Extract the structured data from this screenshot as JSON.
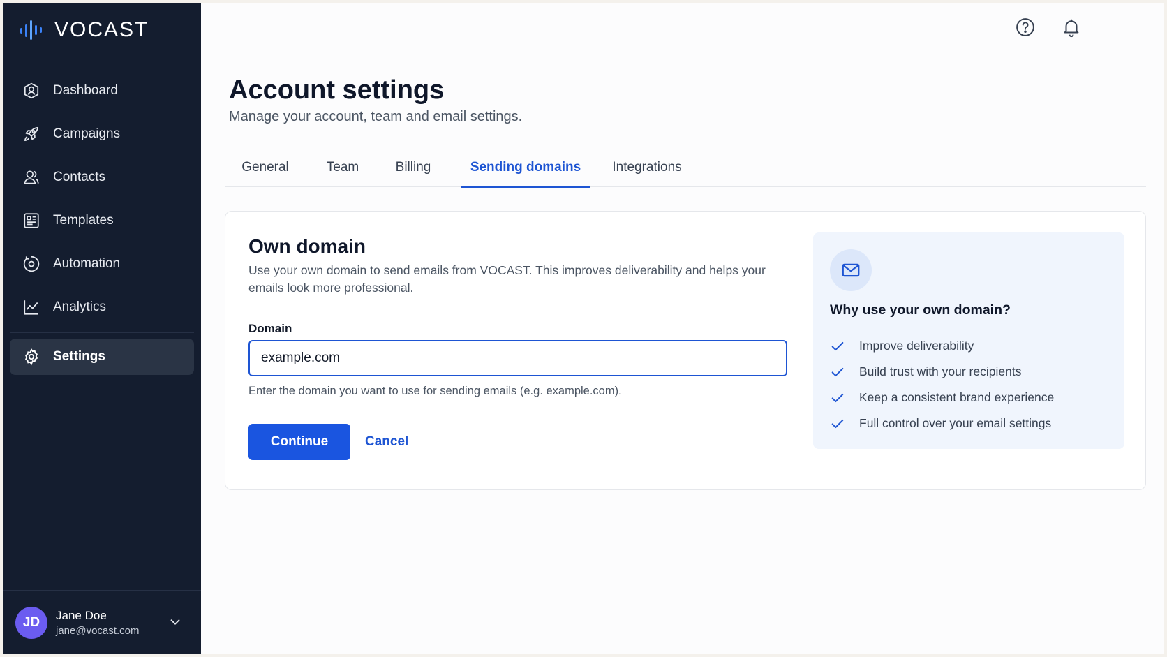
{
  "brand": {
    "name": "VOCAST",
    "accent": "#1a55e0",
    "sidebar_bg": "#141d2f"
  },
  "sidebar": {
    "items": [
      {
        "label": "Dashboard",
        "icon": "dashboard-icon"
      },
      {
        "label": "Campaigns",
        "icon": "rocket-icon"
      },
      {
        "label": "Contacts",
        "icon": "contacts-icon"
      },
      {
        "label": "Templates",
        "icon": "templates-icon"
      },
      {
        "label": "Automation",
        "icon": "automation-icon"
      },
      {
        "label": "Analytics",
        "icon": "analytics-icon"
      }
    ],
    "settings": {
      "label": "Settings",
      "icon": "gear-icon",
      "active": true
    },
    "user": {
      "initials": "JD",
      "name": "Jane Doe",
      "email": "jane@vocast.com"
    }
  },
  "header": {
    "title": "Account settings",
    "subtitle": "Manage your account, team and email settings."
  },
  "tabs": [
    {
      "label": "General"
    },
    {
      "label": "Team"
    },
    {
      "label": "Billing"
    },
    {
      "label": "Sending domains",
      "active": true
    },
    {
      "label": "Integrations"
    }
  ],
  "own_domain": {
    "title": "Own domain",
    "description": "Use your own domain to send emails from VOCAST. This improves deliverability and helps your emails look more professional.",
    "field_label": "Domain",
    "field_value": "example.com",
    "help_text": "Enter the domain you want to use for sending emails (e.g. example.com).",
    "continue_label": "Continue",
    "cancel_label": "Cancel"
  },
  "info_panel": {
    "icon": "mail-icon",
    "title": "Why use your own domain?",
    "benefits": [
      "Improve deliverability",
      "Build trust with your recipients",
      "Keep a consistent brand experience",
      "Full control over your email settings"
    ]
  }
}
